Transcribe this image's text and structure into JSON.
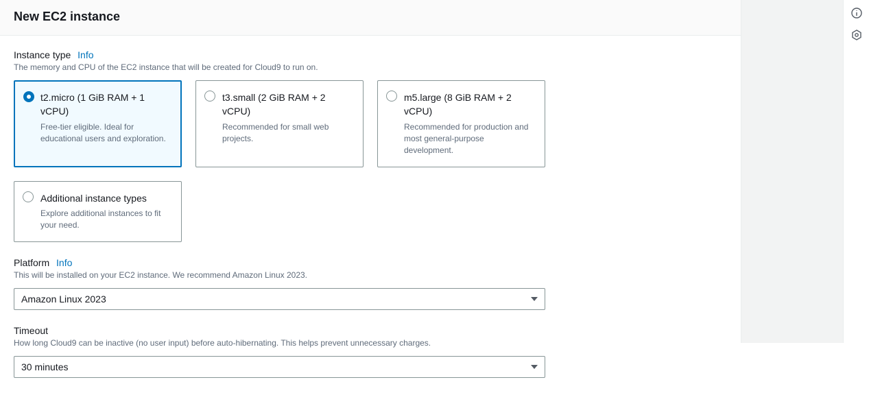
{
  "header": {
    "title": "New EC2 instance"
  },
  "instanceType": {
    "label": "Instance type",
    "info": "Info",
    "help": "The memory and CPU of the EC2 instance that will be created for Cloud9 to run on.",
    "tiles": [
      {
        "title": "t2.micro (1 GiB RAM + 1 vCPU)",
        "desc": "Free-tier eligible. Ideal for educational users and exploration.",
        "selected": true
      },
      {
        "title": "t3.small (2 GiB RAM + 2 vCPU)",
        "desc": "Recommended for small web projects.",
        "selected": false
      },
      {
        "title": "m5.large (8 GiB RAM + 2 vCPU)",
        "desc": "Recommended for production and most general-purpose development.",
        "selected": false
      }
    ],
    "additional": {
      "title": "Additional instance types",
      "desc": "Explore additional instances to fit your need."
    }
  },
  "platform": {
    "label": "Platform",
    "info": "Info",
    "help": "This will be installed on your EC2 instance. We recommend Amazon Linux 2023.",
    "value": "Amazon Linux 2023"
  },
  "timeout": {
    "label": "Timeout",
    "help": "How long Cloud9 can be inactive (no user input) before auto-hibernating. This helps prevent unnecessary charges.",
    "value": "30 minutes"
  }
}
